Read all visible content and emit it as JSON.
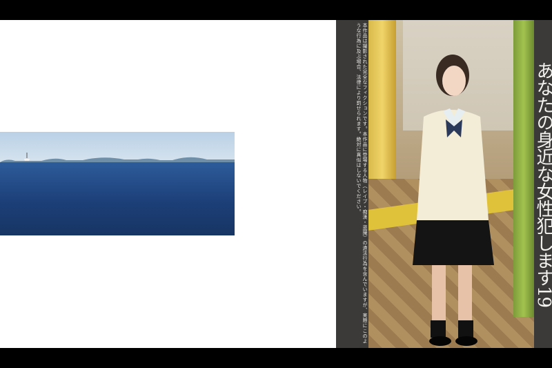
{
  "notice_text": "本作品は撮影された完全なフィクションです。本作品に登場する人物（レイプ・痴漢・盗撮）の違法行為を含んでいますが、実際にこのような行為に及ぶ場合、法律により罰せられます。絶対に真似はしないでください。",
  "title_text": "あなたの身近な女性犯します19",
  "colors": {
    "background_bar": "#000000",
    "panel_white": "#ffffff",
    "panel_dark": "#3b3a39",
    "sea_blue": "#1c3f78",
    "sky": "#c7d9ea"
  }
}
